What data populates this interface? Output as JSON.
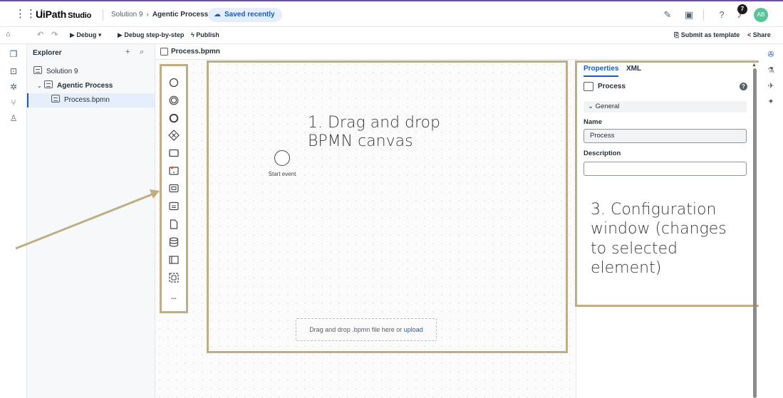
{
  "header": {
    "brand_ui": "UiPath",
    "brand_studio": "Studio",
    "breadcrumb": [
      "Solution 9",
      "Agentic Process"
    ],
    "breadcrumb_sep": "›",
    "saved_status": "Saved recently",
    "notification_count": "7",
    "avatar_initials": "AB"
  },
  "toolbar": {
    "debug": "Debug",
    "debug_step": "Debug step-by-step",
    "publish": "Publish",
    "submit_template": "Submit as template",
    "share": "Share"
  },
  "explorer": {
    "title": "Explorer",
    "add": "+",
    "search": "⌕",
    "tree": [
      {
        "label": "Solution 9"
      },
      {
        "label": "Agentic Process"
      },
      {
        "label": "Process.bpmn"
      }
    ]
  },
  "editor": {
    "tab": "Process.bpmn",
    "start_event_label": "Start event",
    "drop_text": "Drag and drop .bpmn file here or",
    "drop_link": "upload",
    "palette_more": "..."
  },
  "annotations": {
    "canvas_line1": "1. Drag and drop",
    "canvas_line2": "BPMN canvas",
    "config_line1": "3. Configuration",
    "config_line2": "window (changes",
    "config_line3": "to selected",
    "config_line4": "element)"
  },
  "properties": {
    "tabs": [
      "Properties",
      "XML"
    ],
    "element": "Process",
    "help": "?",
    "section": "General",
    "name_label": "Name",
    "name_value": "Process",
    "description_label": "Description",
    "description_value": ""
  },
  "colors": {
    "accent": "#1a5bbf",
    "annotation": "#bfae85",
    "avatar": "#57c49a"
  }
}
